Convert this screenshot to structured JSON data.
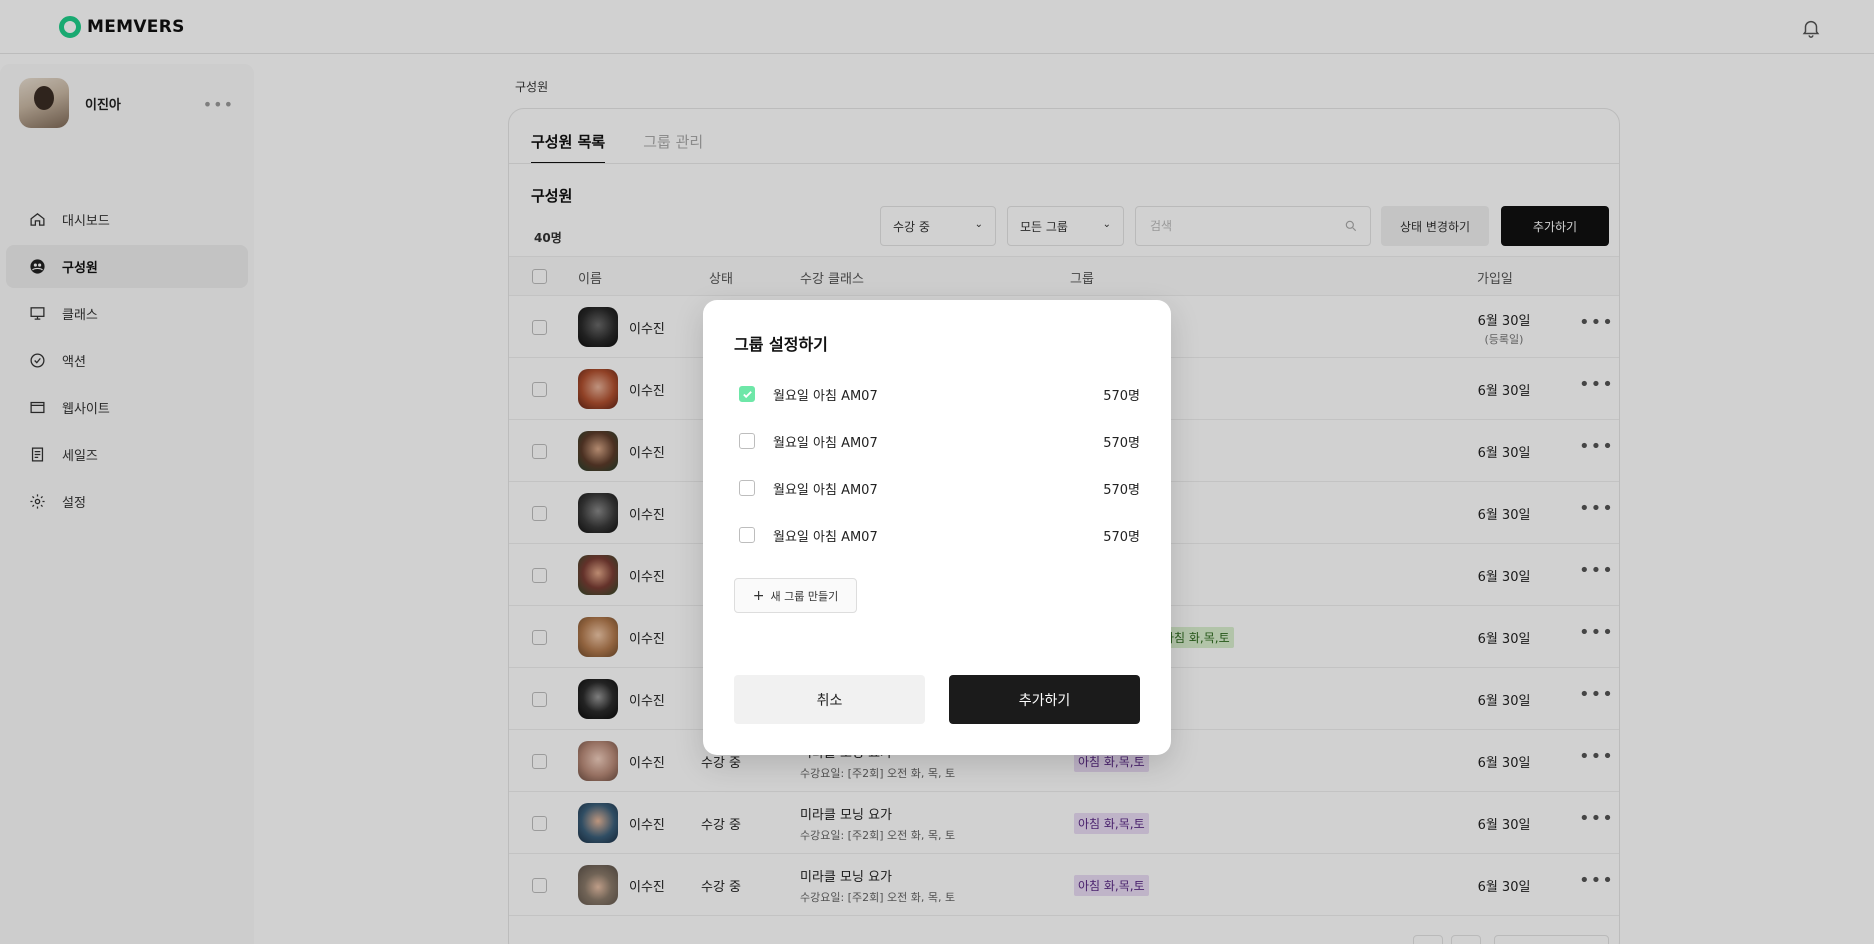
{
  "app": {
    "logo_text": "MEMVERS",
    "brand_color": "#1fcf8a"
  },
  "sidebar": {
    "profile_name": "이진아",
    "items": [
      {
        "label": "대시보드",
        "icon": "home-icon",
        "active": false
      },
      {
        "label": "구성원",
        "icon": "members-icon",
        "active": true
      },
      {
        "label": "클래스",
        "icon": "presentation-icon",
        "active": false
      },
      {
        "label": "액션",
        "icon": "check-circle-icon",
        "active": false
      },
      {
        "label": "웹사이트",
        "icon": "browser-icon",
        "active": false
      },
      {
        "label": "세일즈",
        "icon": "receipt-icon",
        "active": false
      },
      {
        "label": "설정",
        "icon": "gear-icon",
        "active": false
      }
    ]
  },
  "main": {
    "breadcrumb": "구성원",
    "tabs": [
      {
        "label": "구성원 목록",
        "active": true
      },
      {
        "label": "그룹 관리",
        "active": false
      }
    ],
    "section_title": "구성원",
    "count": "40명",
    "filters": {
      "status": "수강 중",
      "group": "모든 그룹",
      "search_placeholder": "검색"
    },
    "buttons": {
      "status_change": "상태 변경하기",
      "add": "추가하기"
    },
    "table": {
      "headers": {
        "name": "이름",
        "status": "상태",
        "class": "수강 클래스",
        "group": "그룹",
        "joined": "가입일"
      },
      "rows": [
        {
          "name": "이수진",
          "date": "6월 30일",
          "sub": "(등록일)"
        },
        {
          "name": "이수진",
          "date": "6월 30일"
        },
        {
          "name": "이수진",
          "date": "6월 30일"
        },
        {
          "name": "이수진",
          "date": "6월 30일"
        },
        {
          "name": "이수진",
          "date": "6월 30일"
        },
        {
          "name": "이수진",
          "date": "6월 30일",
          "group": "아침 화,목,토"
        },
        {
          "name": "이수진",
          "date": "6월 30일"
        },
        {
          "name": "이수진",
          "status": "수강 중",
          "class": "미라클 모닝 요가",
          "class_sub": "수강요일: [주2회] 오전 화, 목, 토",
          "group": "아침 화,목,토",
          "date": "6월 30일"
        },
        {
          "name": "이수진",
          "status": "수강 중",
          "class": "미라클 모닝 요가",
          "class_sub": "수강요일: [주2회] 오전 화, 목, 토",
          "group": "아침 화,목,토",
          "date": "6월 30일"
        },
        {
          "name": "이수진",
          "status": "수강 중",
          "class": "미라클 모닝 요가",
          "class_sub": "수강요일: [주2회] 오전 화, 목, 토",
          "group": "아침 화,목,토",
          "date": "6월 30일"
        }
      ]
    }
  },
  "modal": {
    "title": "그룹 설정하기",
    "options": [
      {
        "label": "월요일 아침 AM07",
        "count": "570명",
        "checked": true
      },
      {
        "label": "월요일 아침 AM07",
        "count": "570명",
        "checked": false
      },
      {
        "label": "월요일 아침 AM07",
        "count": "570명",
        "checked": false
      },
      {
        "label": "월요일 아침 AM07",
        "count": "570명",
        "checked": false
      }
    ],
    "new_group_label": "새 그룹 만들기",
    "cancel_label": "취소",
    "confirm_label": "추가하기"
  }
}
